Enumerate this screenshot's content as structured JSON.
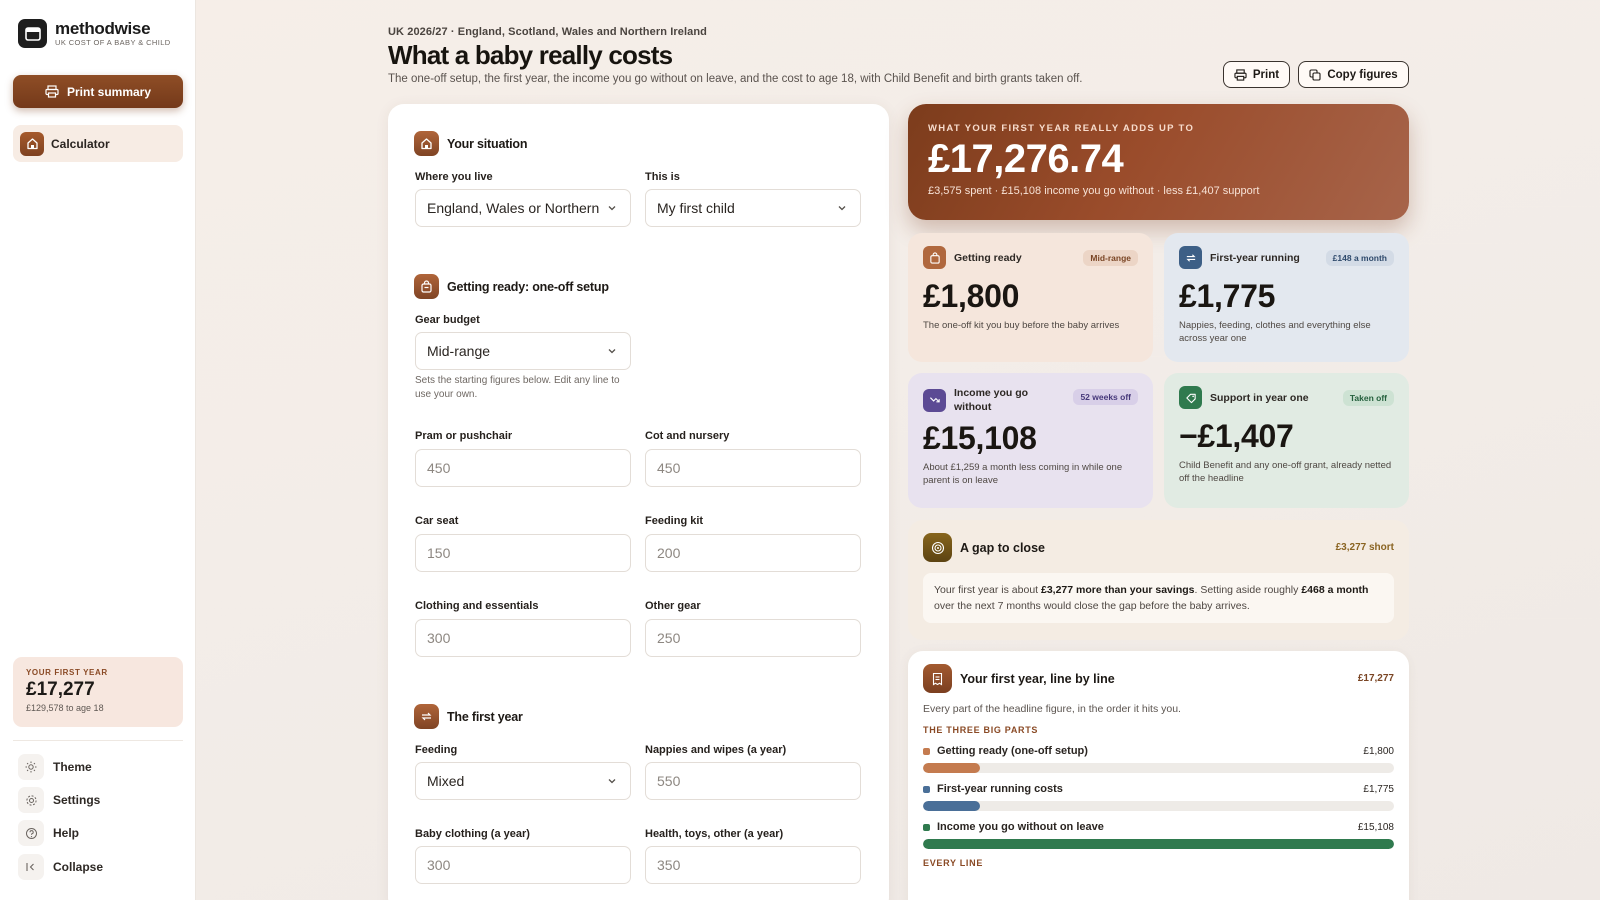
{
  "brand": {
    "name": "methodwise",
    "subtitle": "UK COST OF A BABY & CHILD"
  },
  "sidebar": {
    "print_summary_label": "Print summary",
    "nav": [
      {
        "label": "Calculator",
        "icon": "home-icon",
        "active": true
      }
    ],
    "year_card": {
      "kicker": "YOUR FIRST YEAR",
      "value": "£17,277",
      "sub": "£129,578 to age 18"
    },
    "footer_items": [
      {
        "label": "Theme",
        "icon": "sun-icon"
      },
      {
        "label": "Settings",
        "icon": "gear-icon"
      },
      {
        "label": "Help",
        "icon": "help-icon"
      },
      {
        "label": "Collapse",
        "icon": "collapse-icon"
      }
    ]
  },
  "header": {
    "kicker": "UK 2026/27 · England, Scotland, Wales and Northern Ireland",
    "title": "What a baby really costs",
    "description": "The one-off setup, the first year, the income you go without on leave, and the cost to age 18, with Child Benefit and birth grants taken off.",
    "print_label": "Print",
    "copy_label": "Copy figures"
  },
  "form": {
    "situation": {
      "title": "Your situation",
      "where_label": "Where you live",
      "where_value": "England, Wales or Northern Ireland",
      "this_is_label": "This is",
      "this_is_value": "My first child"
    },
    "getting_ready": {
      "title": "Getting ready: one-off setup",
      "gear_budget_label": "Gear budget",
      "gear_budget_value": "Mid-range",
      "gear_help": "Sets the starting figures below. Edit any line to use your own.",
      "pram_label": "Pram or pushchair",
      "pram_placeholder": "450",
      "cot_label": "Cot and nursery",
      "cot_placeholder": "450",
      "car_seat_label": "Car seat",
      "car_seat_placeholder": "150",
      "feeding_kit_label": "Feeding kit",
      "feeding_kit_placeholder": "200",
      "clothing_label": "Clothing and essentials",
      "clothing_placeholder": "300",
      "other_gear_label": "Other gear",
      "other_gear_placeholder": "250"
    },
    "first_year": {
      "title": "The first year",
      "feeding_label": "Feeding",
      "feeding_value": "Mixed",
      "nappies_label": "Nappies and wipes (a year)",
      "nappies_placeholder": "550",
      "baby_clothing_label": "Baby clothing (a year)",
      "baby_clothing_placeholder": "300",
      "health_label": "Health, toys, other (a year)",
      "health_placeholder": "350"
    }
  },
  "summary": {
    "hero": {
      "kicker": "WHAT YOUR FIRST YEAR REALLY ADDS UP TO",
      "value": "£17,276.74",
      "sub": "£3,575 spent · £15,108 income you go without · less £1,407 support"
    },
    "tiles": {
      "ready": {
        "name": "Getting ready",
        "badge": "Mid-range",
        "amount": "£1,800",
        "desc": "The one-off kit you buy before the baby arrives",
        "color": "#a95e34"
      },
      "running": {
        "name": "First-year running",
        "badge": "£148 a month",
        "amount": "£1,775",
        "desc": "Nappies, feeding, clothes and everything else across year one",
        "color": "#3d5f86"
      },
      "income": {
        "name": "Income you go without",
        "badge": "52 weeks off",
        "amount": "£15,108",
        "desc": "About £1,259 a month less coming in while one parent is on leave",
        "color": "#5c4a94"
      },
      "support": {
        "name": "Support in year one",
        "badge": "Taken off",
        "amount": "−£1,407",
        "desc": "Child Benefit and any one-off grant, already netted off the headline",
        "color": "#2f7a4e"
      }
    },
    "gap": {
      "title": "A gap to close",
      "short": "£3,277 short",
      "text_a": "Your first year is about ",
      "text_b": "£3,277 more than your savings",
      "text_c": ". Setting aside roughly ",
      "text_d": "£468 a month",
      "text_e": " over the next 7 months would close the gap before the baby arrives."
    },
    "lines": {
      "title": "Your first year, line by line",
      "total": "£17,277",
      "sub": "Every part of the headline figure, in the order it hits you.",
      "section_big": "THE THREE BIG PARTS",
      "section_every": "EVERY LINE",
      "bars": [
        {
          "label": "Getting ready (one-off setup)",
          "value_text": "£1,800",
          "value": 1800,
          "color": "#c47b4f"
        },
        {
          "label": "First-year running costs",
          "value_text": "£1,775",
          "value": 1775,
          "color": "#4a6f98"
        },
        {
          "label": "Income you go without on leave",
          "value_text": "£15,108",
          "value": 15108,
          "color": "#2f7a4e"
        }
      ]
    }
  }
}
